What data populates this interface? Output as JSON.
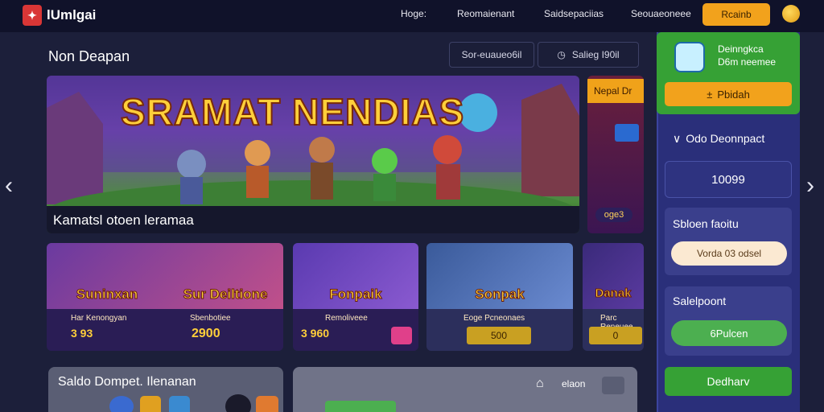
{
  "app": {
    "brand": "lUmlgai",
    "brand_icon": "logo-mark"
  },
  "nav": {
    "items": [
      "Hoge:",
      "Reomaienant",
      "Saidsepaciias",
      "Seouaeoneee"
    ],
    "login": "Rcainb"
  },
  "section": {
    "title": "Non Deapan"
  },
  "filters": {
    "left": "Sor-euaueo6il",
    "right": "Salieg I90il"
  },
  "banner": {
    "title": "SRAMAT NENDIAS",
    "caption": "Kamatsl otoen leramaa"
  },
  "side_promo": {
    "tag": "Nepal Dr",
    "badge": "oge3"
  },
  "cards": [
    {
      "title": "Suninxan",
      "label": "Har Kenongyan",
      "value": "3  93"
    },
    {
      "title": "Sur Deiltione",
      "label": "Sbenbotiee",
      "value": "2900"
    },
    {
      "title": "Fonpaik",
      "label": "Remoliveee",
      "value": "3  960"
    },
    {
      "title": "Sonpak",
      "label": "Eoge Pcneonaes",
      "value": "500"
    },
    {
      "title": "Danak",
      "label": "Parc Reneuee",
      "value": "0"
    }
  ],
  "bottom": {
    "left_title": "Saldo Dompet. Ilenanan",
    "right_label": "elaon"
  },
  "wallet": {
    "name": "Deinngkca",
    "sub": "D6m neemee",
    "button": "Pbidah"
  },
  "panel": {
    "deposit_heading": "Odo Deonnpact",
    "balance": "10099",
    "section2_heading": "Sbloen faoitu",
    "pill_text": "Vorda  03  odsel",
    "section3_heading": "Salelpoont",
    "green_btn": "6Pulcen",
    "bottom_btn": "Dedharv"
  },
  "colors": {
    "accent": "#f2a21c",
    "wallet": "#36a135",
    "panel": "#2a2f7a"
  }
}
